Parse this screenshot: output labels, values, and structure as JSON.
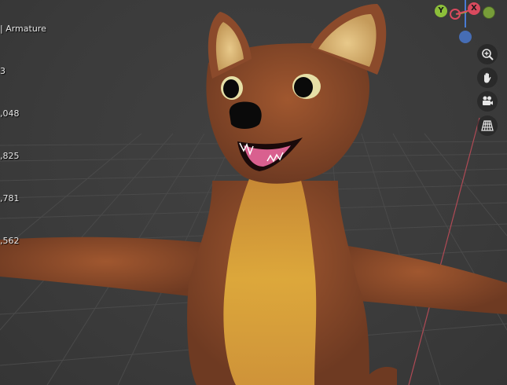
{
  "viewport": {
    "object_info_label": "| Armature",
    "stats": [
      "3",
      ",048",
      ",825",
      ",781",
      ",562"
    ]
  },
  "gizmo": {
    "axes": [
      {
        "label": "Y",
        "color": "#8cbf3a"
      },
      {
        "label": "X",
        "color": "#d94a5e"
      },
      {
        "label": "",
        "color": "#d94a5e"
      },
      {
        "label": "",
        "color": "#8cbf3a"
      },
      {
        "label": "",
        "color": "#4a7bd4"
      }
    ]
  },
  "nav_buttons": [
    {
      "name": "zoom",
      "icon": "zoom-icon"
    },
    {
      "name": "pan",
      "icon": "hand-icon"
    },
    {
      "name": "camera",
      "icon": "camera-icon"
    },
    {
      "name": "perspective",
      "icon": "grid-icon"
    }
  ],
  "colors": {
    "viewport_bg": "#3d3d3d",
    "grid_line": "#4a4a4a",
    "x_axis_line": "#b04a55",
    "fur_main": "#8b4a2b",
    "fur_belly": "#d9a23a",
    "nose": "#0a0a0a",
    "tongue": "#d9608f"
  }
}
